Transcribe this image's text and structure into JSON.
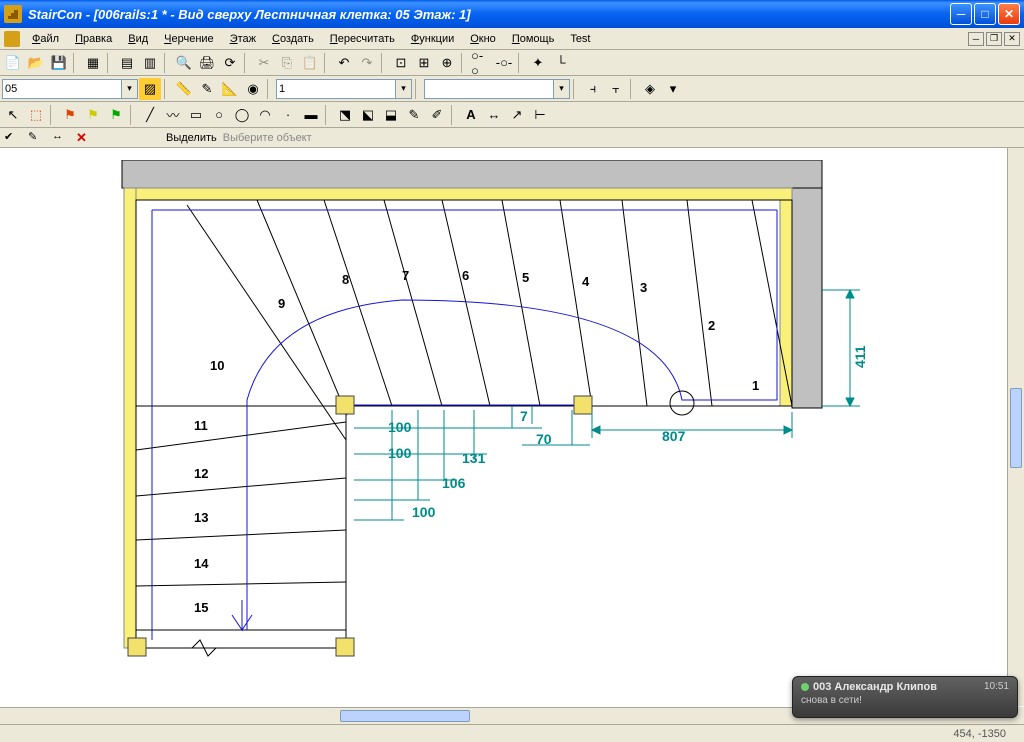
{
  "window": {
    "title": "StairCon - [006rails:1 * - Вид сверху Лестничная клетка: 05 Этаж: 1]"
  },
  "menu": {
    "file": "Файл",
    "edit": "Правка",
    "view": "Вид",
    "draw": "Черчение",
    "floor": "Этаж",
    "create": "Создать",
    "recalc": "Пересчитать",
    "functions": "Функции",
    "window": "Окно",
    "help": "Помощь",
    "test": "Test"
  },
  "toolbar2": {
    "combo1": "05",
    "combo2": "1"
  },
  "prompt": {
    "label": "Выделить",
    "hint": "Выберите объект"
  },
  "steps": {
    "s1": "1",
    "s2": "2",
    "s3": "3",
    "s4": "4",
    "s5": "5",
    "s6": "6",
    "s7": "7",
    "s8": "8",
    "s9": "9",
    "s10": "10",
    "s11": "11",
    "s12": "12",
    "s13": "13",
    "s14": "14",
    "s15": "15"
  },
  "dims": {
    "d411": "411",
    "d807": "807",
    "d7": "7",
    "d70": "70",
    "d131": "131",
    "d106": "106",
    "d100a": "100",
    "d100b": "100",
    "d100c": "100"
  },
  "status": {
    "coords": "454, -1350"
  },
  "notif": {
    "title": "003 Александр Клипов",
    "time": "10:51",
    "msg": "снова в сети!"
  }
}
